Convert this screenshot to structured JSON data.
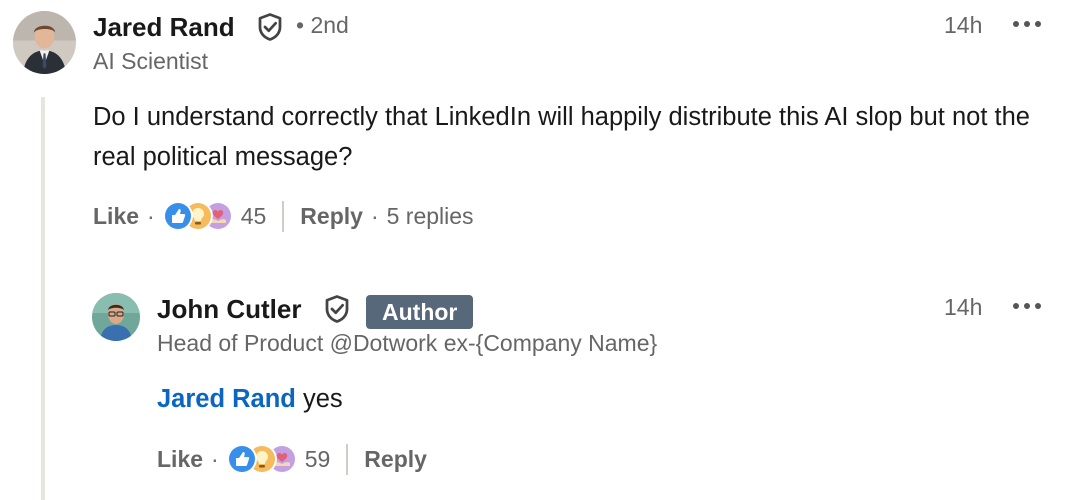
{
  "comment": {
    "author": "Jared Rand",
    "degree": "• 2nd",
    "headline": "AI Scientist",
    "time": "14h",
    "text": "Do I understand correctly that LinkedIn will happily distribute this AI slop but not the real political message?",
    "like_label": "Like",
    "reaction_count": "45",
    "reply_label": "Reply",
    "replies_label": "5 replies",
    "reactions": [
      "like-icon",
      "insightful-icon",
      "support-icon"
    ]
  },
  "reply": {
    "author": "John Cutler",
    "badge": "Author",
    "headline": "Head of Product @Dotwork ex-{Company Name}",
    "time": "14h",
    "mention": "Jared Rand",
    "text": "yes",
    "like_label": "Like",
    "reaction_count": "59",
    "reply_label": "Reply",
    "reactions": [
      "like-icon",
      "insightful-icon",
      "support-icon"
    ]
  },
  "colors": {
    "link_blue": "#0a66c2",
    "badge_gray": "#56687a",
    "secondary_text": "#666666",
    "like_blue": "#378fe9",
    "insightful_yellow": "#f5bb5c",
    "support_purple": "#c5a0e0"
  }
}
